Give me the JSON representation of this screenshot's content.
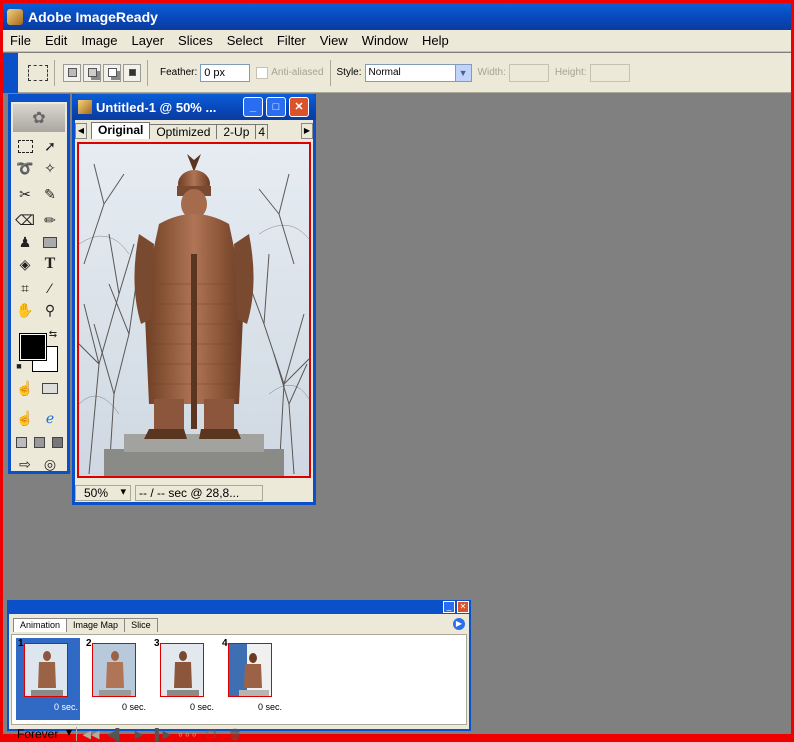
{
  "app": {
    "title": "Adobe ImageReady"
  },
  "menu": [
    {
      "label": "File"
    },
    {
      "label": "Edit"
    },
    {
      "label": "Image"
    },
    {
      "label": "Layer"
    },
    {
      "label": "Slices"
    },
    {
      "label": "Select"
    },
    {
      "label": "Filter"
    },
    {
      "label": "View"
    },
    {
      "label": "Window"
    },
    {
      "label": "Help"
    }
  ],
  "options": {
    "feather_label": "Feather:",
    "feather_value": "0 px",
    "antialias_label": "Anti-aliased",
    "style_label": "Style:",
    "style_value": "Normal",
    "width_label": "Width:",
    "height_label": "Height:"
  },
  "document": {
    "title": "Untitled-1 @ 50% ...",
    "tabs": [
      "Original",
      "Optimized",
      "2-Up",
      "4"
    ],
    "active_tab": "Original",
    "zoom": "50%",
    "timing": "-- / -- sec @ 28,8..."
  },
  "animation": {
    "tabs": [
      "Animation",
      "Image Map",
      "Slice"
    ],
    "frames": [
      {
        "num": "1",
        "delay": "0 sec."
      },
      {
        "num": "2",
        "delay": "0 sec."
      },
      {
        "num": "3",
        "delay": "0 sec."
      },
      {
        "num": "4",
        "delay": "0 sec."
      }
    ],
    "loop": "Forever"
  },
  "colors": {
    "xp_blue": "#0a50c8",
    "frame_border": "#d00",
    "selected_frame": "#316ac5"
  }
}
